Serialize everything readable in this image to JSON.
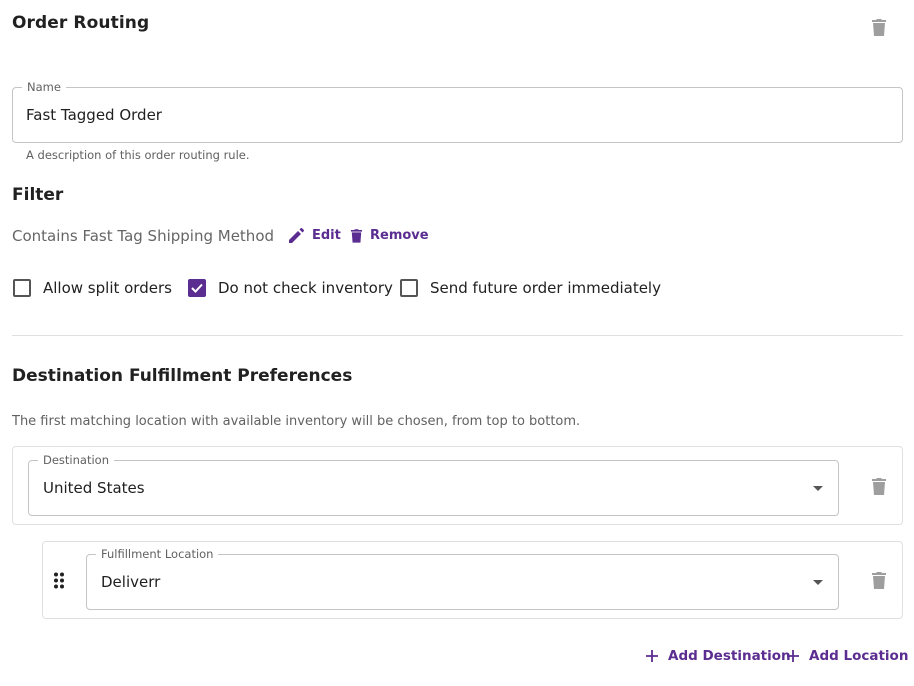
{
  "header": {
    "title": "Order Routing",
    "delete_icon": "trash-icon"
  },
  "name_field": {
    "label": "Name",
    "value": "Fast Tagged Order",
    "helper": "A description of this order routing rule."
  },
  "filter": {
    "title": "Filter",
    "condition": "Contains Fast Tag Shipping Method",
    "edit_label": "Edit",
    "remove_label": "Remove"
  },
  "options": [
    {
      "label": "Allow split orders",
      "checked": false
    },
    {
      "label": "Do not check inventory",
      "checked": true
    },
    {
      "label": "Send future order immediately",
      "checked": false
    }
  ],
  "destinations": {
    "title": "Destination Fulfillment Preferences",
    "description": "The first matching location with available inventory will be chosen, from top to bottom.",
    "destination": {
      "label": "Destination",
      "value": "United States"
    },
    "location": {
      "label": "Fulfillment Location",
      "value": "Deliverr"
    },
    "add_destination_label": "Add Destination",
    "add_location_label": "Add Location"
  },
  "colors": {
    "accent": "#5b2d90",
    "border": "#c4c4c4",
    "muted": "#616161"
  }
}
